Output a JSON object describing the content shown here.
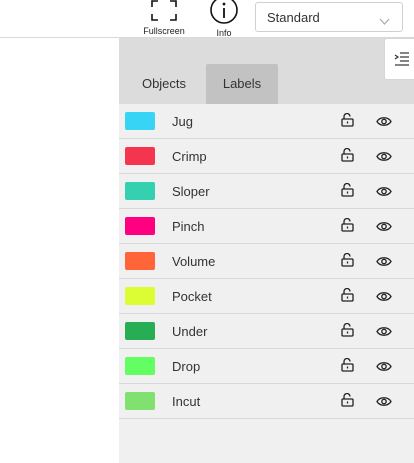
{
  "toolbar": {
    "fullscreen_label": "Fullscreen",
    "info_label": "Info",
    "select_value": "Standard"
  },
  "panel": {
    "tabs": [
      {
        "label": "Objects",
        "active": false
      },
      {
        "label": "Labels",
        "active": true
      }
    ]
  },
  "labels": [
    {
      "name": "Jug",
      "color": "#38d4f5"
    },
    {
      "name": "Crimp",
      "color": "#f5344f"
    },
    {
      "name": "Sloper",
      "color": "#34d0b0"
    },
    {
      "name": "Pinch",
      "color": "#ff0080"
    },
    {
      "name": "Volume",
      "color": "#ff6538"
    },
    {
      "name": "Pocket",
      "color": "#dcfc34"
    },
    {
      "name": "Under",
      "color": "#27ae55"
    },
    {
      "name": "Drop",
      "color": "#62fe62"
    },
    {
      "name": "Incut",
      "color": "#80e070"
    }
  ],
  "icons": {
    "fullscreen": "fullscreen-icon",
    "info": "info-icon",
    "chevron": "chevron-down-icon",
    "collapse": "collapse-panel-icon",
    "lock": "lock-icon",
    "eye": "eye-icon"
  }
}
